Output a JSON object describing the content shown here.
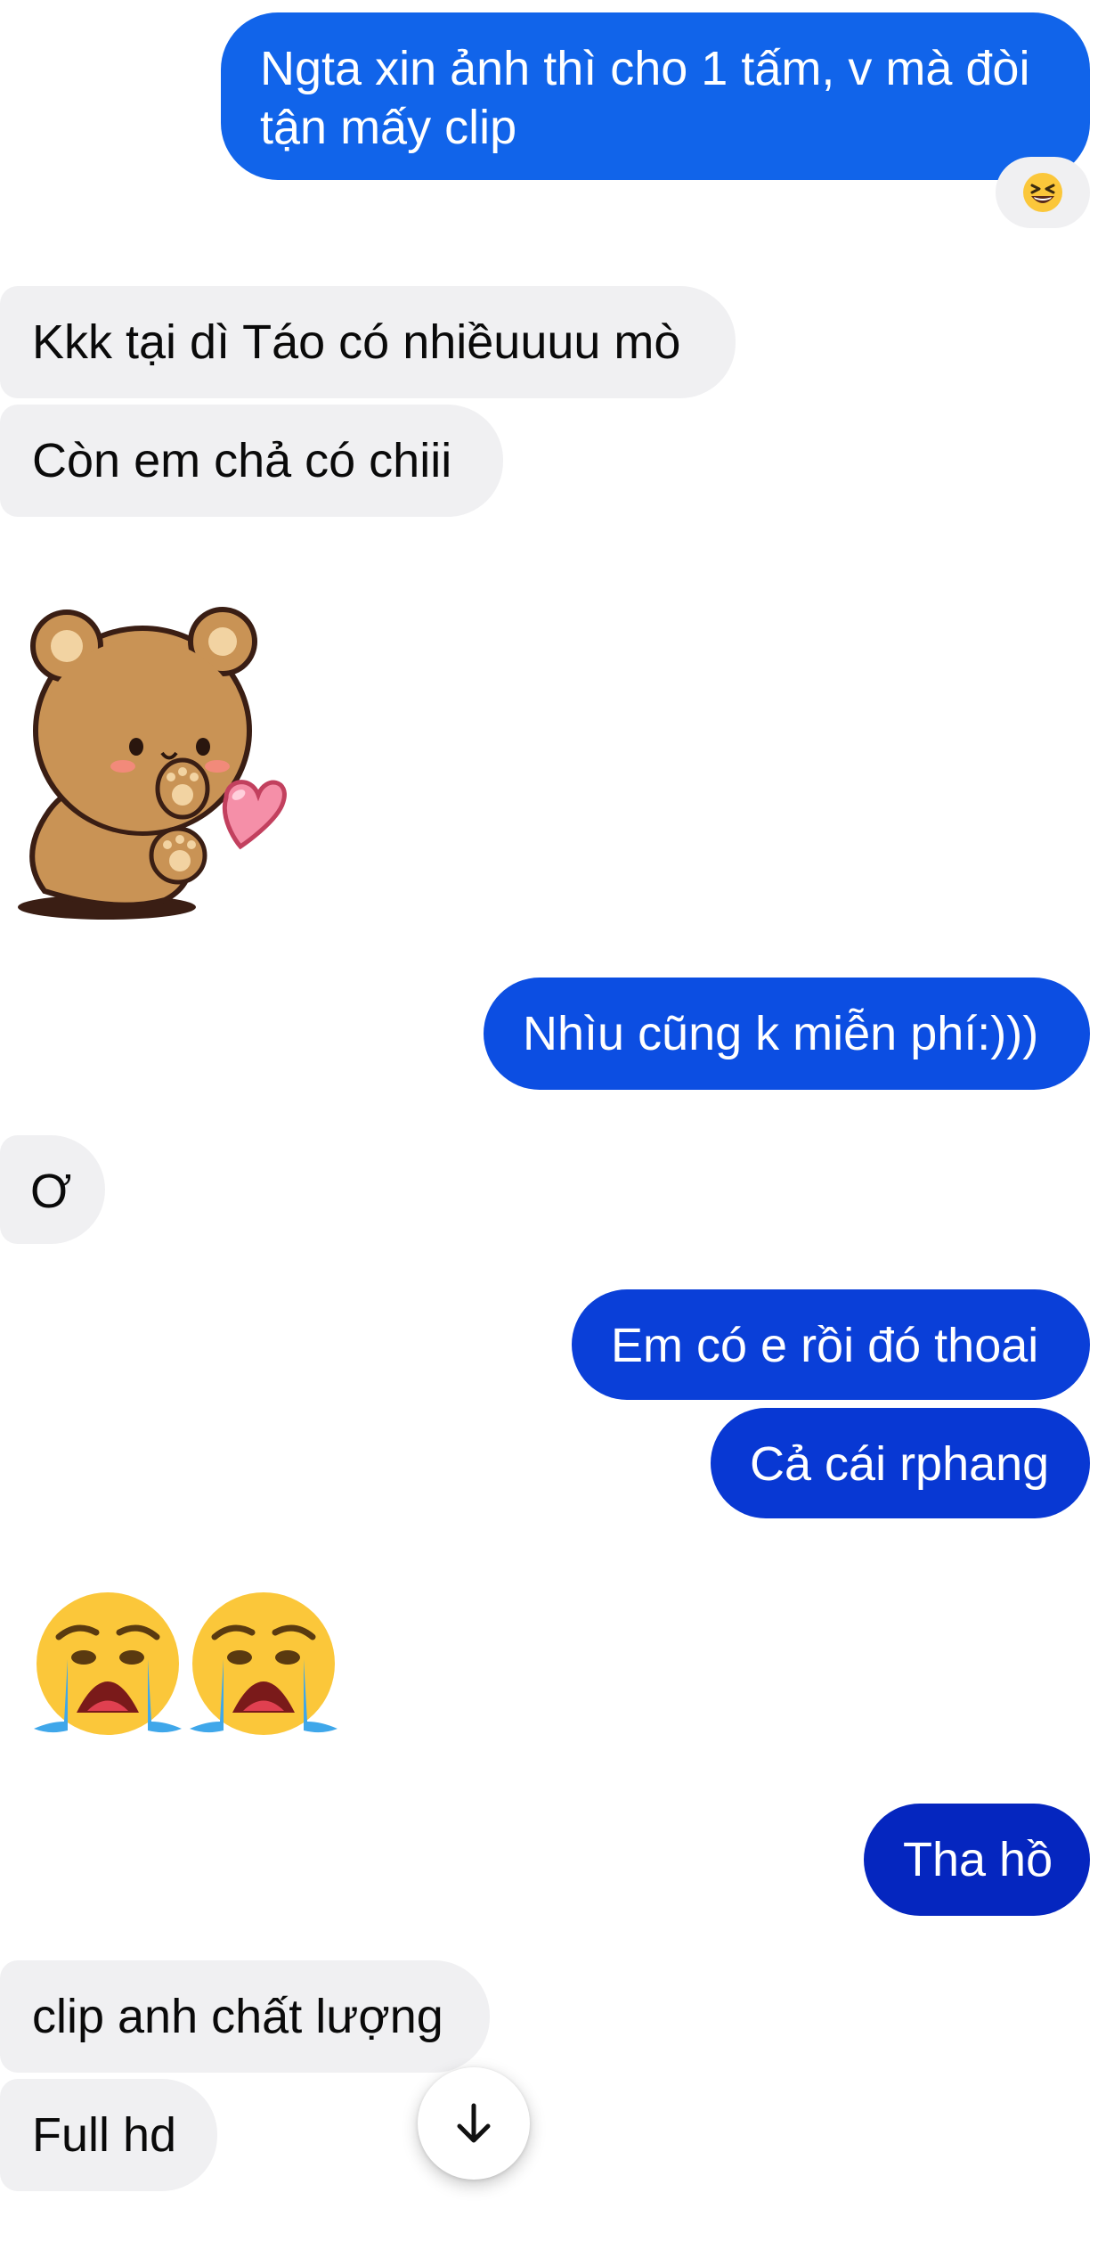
{
  "messages": {
    "m1": "Ngta xin ảnh thì cho 1 tấm, v mà đòi tận mấy clip",
    "m2": "Kkk tại dì Táo có nhiềuuuu mò",
    "m3": "Còn em chả có chiii",
    "m4": "Nhìu cũng k miễn phí:)))",
    "m5": "Ơ",
    "m6": "Em có e rồi đó thoai",
    "m7": "Cả cái rphang",
    "m8": "Tha hồ",
    "m9": "clip anh chất lượng",
    "m10": "Full hd"
  },
  "reaction": {
    "icon": "laughing-emoji-icon"
  },
  "sticker": {
    "icon": "bear-heart-sticker"
  },
  "big_emojis": [
    "crying-emoji-icon",
    "crying-emoji-icon"
  ],
  "scroll_button": {
    "icon": "arrow-down-icon"
  },
  "colors": {
    "incoming_bubble": "#f0f0f2",
    "outgoing_top": "#1164ea",
    "outgoing_bottom": "#0526bf",
    "emoji_yellow": "#fbc73a"
  }
}
